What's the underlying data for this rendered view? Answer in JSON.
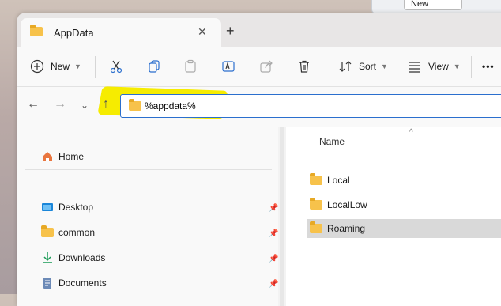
{
  "background_window": {
    "button_label": "New"
  },
  "tab": {
    "title": "AppData",
    "close": "✕",
    "new_tab": "+"
  },
  "toolbar": {
    "new_label": "New",
    "sort_label": "Sort",
    "view_label": "View",
    "more_label": "•••"
  },
  "address": {
    "value": "%appdata%"
  },
  "sidebar": {
    "home": "Home",
    "items": [
      {
        "label": "Desktop",
        "icon": "desktop-icon"
      },
      {
        "label": "common",
        "icon": "folder-icon"
      },
      {
        "label": "Downloads",
        "icon": "download-icon"
      },
      {
        "label": "Documents",
        "icon": "documents-icon"
      }
    ]
  },
  "files": {
    "column_name": "Name",
    "rows": [
      "Local",
      "LocalLow",
      "Roaming"
    ],
    "selected": "Roaming"
  },
  "colors": {
    "accent": "#2b6fce",
    "highlight": "#f6ec00",
    "folder": "#f7c24b"
  }
}
